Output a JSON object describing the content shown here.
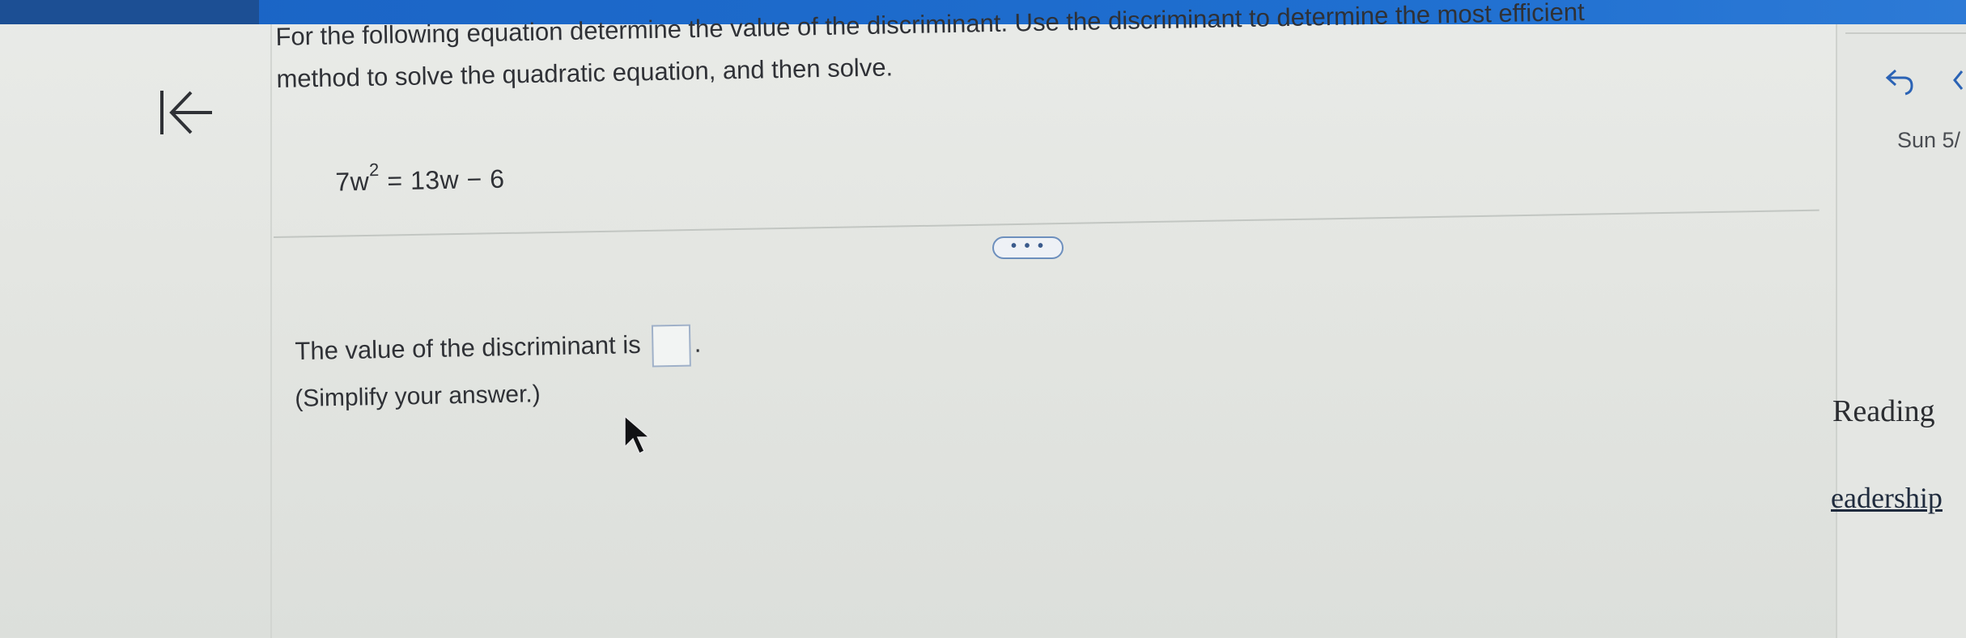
{
  "question": {
    "line1": "For the following equation determine the value of the discriminant. Use the discriminant to determine the most efficient",
    "line2": "method to solve the quadratic equation, and then solve."
  },
  "equation": {
    "lhs": "7w",
    "exponent": "2",
    "rhs": " = 13w − 6"
  },
  "more_button": {
    "label": "• • •"
  },
  "answer": {
    "prompt": "The value of the discriminant is",
    "suffix": ".",
    "value": "",
    "hint": "(Simplify your answer.)"
  },
  "sidebar": {
    "date": "Sun 5/",
    "reading": "Reading",
    "leadership": "eadership"
  },
  "colors": {
    "top_bar": "#1f6fd0",
    "button_border": "#6d8fbd",
    "answer_box_border": "#9fb0c8",
    "text": "#2f3136"
  },
  "icons": {
    "back": "back-to-start-icon",
    "cursor": "mouse-pointer-icon",
    "undo": "undo-arrow-icon",
    "chevron": "chevron-left-icon"
  }
}
